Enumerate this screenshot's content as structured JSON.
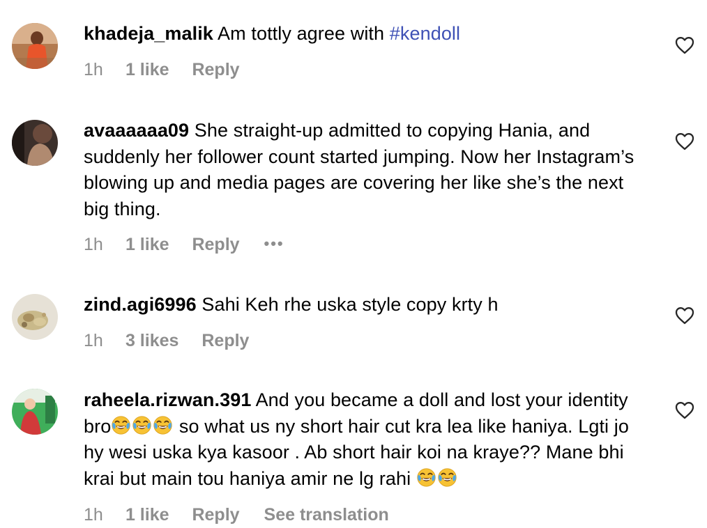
{
  "comments": [
    {
      "username": "khadeja_malik",
      "text": "Am tottly agree with ",
      "hashtag": "#kendoll",
      "time": "1h",
      "likes": "1 like",
      "reply": "Reply",
      "avatar_color": "#e8552b"
    },
    {
      "username": "avaaaaaa09",
      "text": "She straight-up admitted to copying Hania, and suddenly her follower count started jumping. Now her Instagram’s blowing up and media pages are covering her like she’s the next big thing.",
      "time": "1h",
      "likes": "1 like",
      "reply": "Reply",
      "more": "•••",
      "avatar_color": "#6a4a3c"
    },
    {
      "username": "zind.agi6996",
      "text": "Sahi Keh rhe uska style copy krty h",
      "time": "1h",
      "likes": "3 likes",
      "reply": "Reply",
      "avatar_color": "#c9b98a"
    },
    {
      "username": "raheela.rizwan.391",
      "text_part1": "And you became a doll and lost your identity bro",
      "text_part2": " so what us ny short hair cut kra lea like haniya. Lgti jo hy wesi uska kya kasoor . Ab short hair koi na kraye?? Mane bhi krai but main tou haniya amir ne lg rahi ",
      "time": "1h",
      "likes": "1 like",
      "reply": "Reply",
      "translate": "See translation",
      "avatar_color": "#3fae5a"
    }
  ],
  "icons": {
    "heart": "heart-outline-icon",
    "emoji": "face-with-tears-of-joy-icon"
  },
  "colors": {
    "hashtag": "#3f51b5",
    "meta": "#8e8e8e"
  }
}
